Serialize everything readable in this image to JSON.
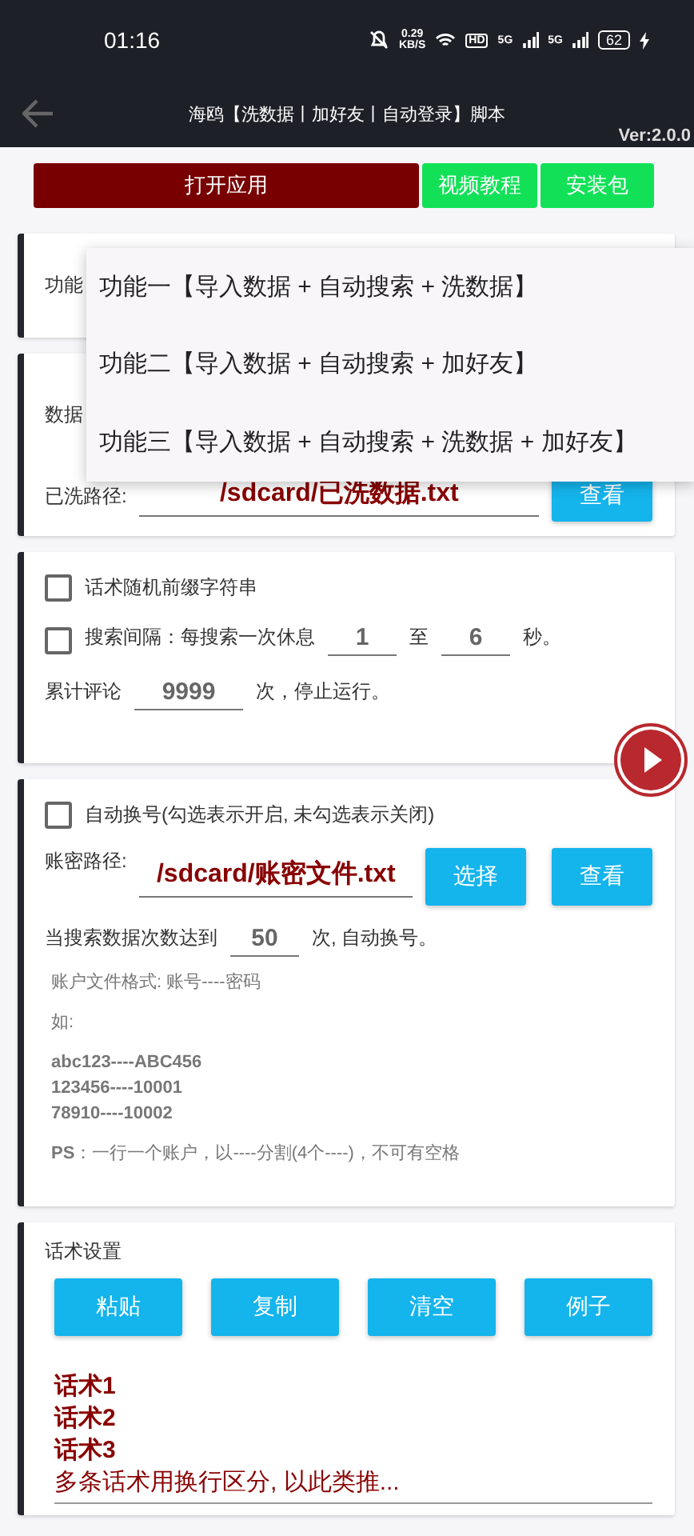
{
  "status_bar": {
    "time": "01:16",
    "speed": "0.29",
    "speed_unit": "KB/S",
    "hd": "HD",
    "network_1": "5G",
    "network_2": "5G",
    "battery": "62"
  },
  "app_bar": {
    "title": "海鸥【洗数据丨加好友丨自动登录】脚本",
    "version": "Ver:2.0.0"
  },
  "top_buttons": [
    {
      "label": "打开应用",
      "kind": "primary"
    },
    {
      "label": "视频教程",
      "kind": "secondary"
    },
    {
      "label": "安装包",
      "kind": "secondary"
    }
  ],
  "function_card": {
    "label": "功能"
  },
  "data_card": {
    "label": "数据",
    "path_label": "已洗路径:",
    "path_value": "/sdcard/已洗数据.txt",
    "button": "查看"
  },
  "dropdown": {
    "options": [
      "功能一【导入数据 + 自动搜索 + 洗数据】",
      "功能二【导入数据 + 自动搜索 + 加好友】",
      "功能三【导入数据 + 自动搜索 + 洗数据 + 加好友】"
    ]
  },
  "options_card": {
    "prefix": {
      "label": "话术随机前缀字符串",
      "checked": false
    },
    "interval": {
      "label": "搜索间隔：每搜索一次休息",
      "checked": false,
      "min": "1",
      "to": "至",
      "max": "6",
      "unit": "秒。"
    },
    "comment": {
      "label": "累计评论",
      "value": "9999",
      "suffix": "次，停止运行。"
    }
  },
  "account_card": {
    "auto_switch": {
      "label": "自动换号(勾选表示开启, 未勾选表示关闭)",
      "checked": false
    },
    "path_label": "账密路径:",
    "path_value": "/sdcard/账密文件.txt",
    "buttons": [
      "选择",
      "查看"
    ],
    "threshold_label": "当搜索数据次数达到",
    "threshold_value": "50",
    "threshold_suffix": "次, 自动换号。",
    "format": "账户文件格式: 账号----密码",
    "example_label": "如:",
    "examples": [
      "abc123----ABC456",
      "123456----10001",
      "78910----10002"
    ],
    "note": "**PS**：一行一个账户，以----分割(4个----)，不可有空格"
  },
  "script_card": {
    "title": "话术设置",
    "buttons": [
      "粘贴",
      "复制",
      "清空",
      "例子"
    ],
    "lines": [
      {
        "text": "话术1",
        "bold": true
      },
      {
        "text": "话术2",
        "bold": true
      },
      {
        "text": "话术3",
        "bold": true
      },
      {
        "text": "多条话术用换行区分, 以此类推...",
        "bold": false
      }
    ]
  }
}
